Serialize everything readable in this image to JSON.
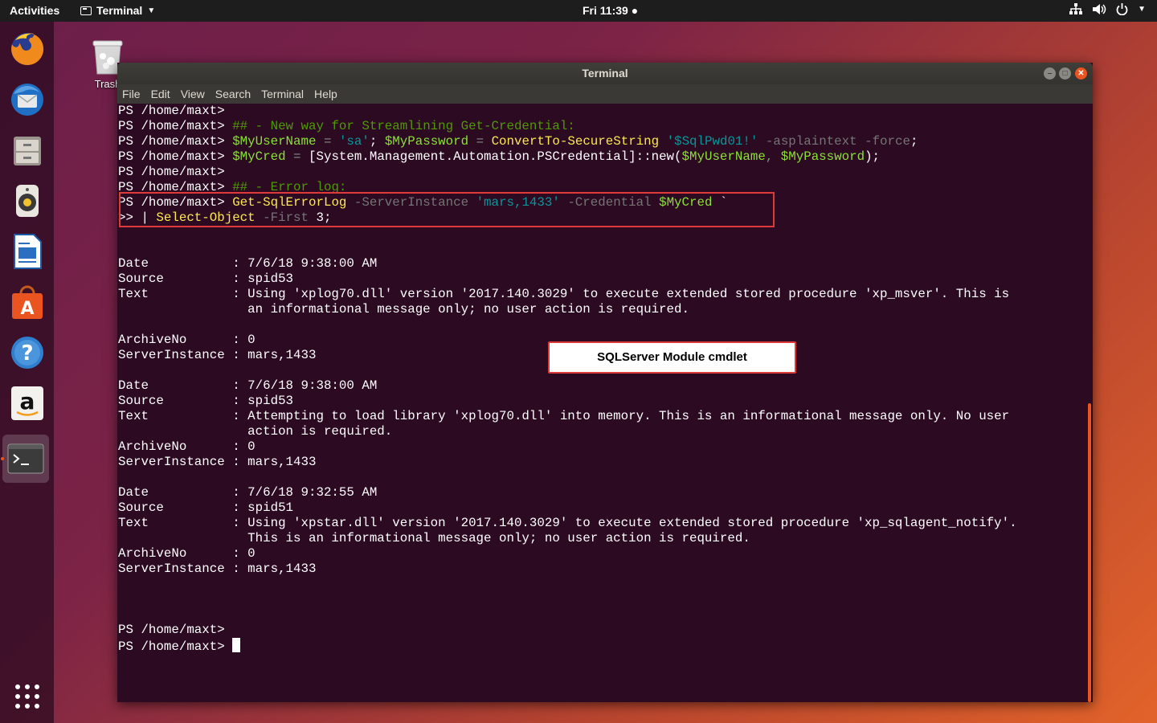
{
  "topbar": {
    "activities": "Activities",
    "app_menu": "Terminal",
    "clock": "Fri 11:39"
  },
  "desktop": {
    "trash_label": "Trash"
  },
  "dock": {
    "items": [
      "firefox-icon",
      "thunderbird-icon",
      "files-icon",
      "rhythmbox-icon",
      "libreoffice-writer-icon",
      "software-center-icon",
      "help-icon",
      "amazon-icon",
      "terminal-icon"
    ],
    "active": "terminal-icon",
    "show_apps": "show-applications-icon"
  },
  "window": {
    "title": "Terminal",
    "menu": [
      "File",
      "Edit",
      "View",
      "Search",
      "Terminal",
      "Help"
    ]
  },
  "terminal": {
    "prompt": "PS /home/maxt>",
    "lines": [
      [
        {
          "t": "PS /home/maxt>",
          "c": ""
        }
      ],
      [
        {
          "t": "PS /home/maxt> ",
          "c": ""
        },
        {
          "t": "## - New way for Streamlining Get-Credential:",
          "c": "cmt"
        }
      ],
      [
        {
          "t": "PS /home/maxt> ",
          "c": ""
        },
        {
          "t": "$MyUserName",
          "c": "var"
        },
        {
          "t": " = ",
          "c": "op"
        },
        {
          "t": "'sa'",
          "c": "str"
        },
        {
          "t": "; ",
          "c": ""
        },
        {
          "t": "$MyPassword",
          "c": "var"
        },
        {
          "t": " = ",
          "c": "op"
        },
        {
          "t": "ConvertTo-SecureString",
          "c": "cmd"
        },
        {
          "t": " ",
          "c": ""
        },
        {
          "t": "'$SqlPwd01!'",
          "c": "str"
        },
        {
          "t": " -asplaintext -force",
          "c": "par"
        },
        {
          "t": ";",
          "c": ""
        }
      ],
      [
        {
          "t": "PS /home/maxt> ",
          "c": ""
        },
        {
          "t": "$MyCred",
          "c": "var"
        },
        {
          "t": " = ",
          "c": "op"
        },
        {
          "t": "[System.Management.Automation.PSCredential]::new(",
          "c": ""
        },
        {
          "t": "$MyUserName",
          "c": "var"
        },
        {
          "t": ", ",
          "c": "op"
        },
        {
          "t": "$MyPassword",
          "c": "var"
        },
        {
          "t": ");",
          "c": ""
        }
      ],
      [
        {
          "t": "PS /home/maxt>",
          "c": ""
        }
      ],
      [
        {
          "t": "PS /home/maxt> ",
          "c": ""
        },
        {
          "t": "## - Error log:",
          "c": "cmt"
        }
      ],
      [
        {
          "t": "PS /home/maxt> ",
          "c": ""
        },
        {
          "t": "Get-SqlErrorLog",
          "c": "cmd"
        },
        {
          "t": " -ServerInstance ",
          "c": "par"
        },
        {
          "t": "'mars,1433'",
          "c": "str"
        },
        {
          "t": " -Credential ",
          "c": "par"
        },
        {
          "t": "$MyCred",
          "c": "var"
        },
        {
          "t": " `",
          "c": ""
        }
      ],
      [
        {
          "t": ">> | ",
          "c": ""
        },
        {
          "t": "Select-Object",
          "c": "cmd"
        },
        {
          "t": " -First",
          "c": "par"
        },
        {
          "t": " 3;",
          "c": ""
        }
      ],
      [
        {
          "t": "",
          "c": ""
        }
      ],
      [
        {
          "t": "",
          "c": ""
        }
      ],
      [
        {
          "t": "Date           : 7/6/18 9:38:00 AM",
          "c": ""
        }
      ],
      [
        {
          "t": "Source         : spid53",
          "c": ""
        }
      ],
      [
        {
          "t": "Text           : Using 'xplog70.dll' version '2017.140.3029' to execute extended stored procedure 'xp_msver'. This is",
          "c": ""
        }
      ],
      [
        {
          "t": "                 an informational message only; no user action is required.",
          "c": ""
        }
      ],
      [
        {
          "t": "",
          "c": ""
        }
      ],
      [
        {
          "t": "ArchiveNo      : 0",
          "c": ""
        }
      ],
      [
        {
          "t": "ServerInstance : mars,1433",
          "c": ""
        }
      ],
      [
        {
          "t": "",
          "c": ""
        }
      ],
      [
        {
          "t": "Date           : 7/6/18 9:38:00 AM",
          "c": ""
        }
      ],
      [
        {
          "t": "Source         : spid53",
          "c": ""
        }
      ],
      [
        {
          "t": "Text           : Attempting to load library 'xplog70.dll' into memory. This is an informational message only. No user",
          "c": ""
        }
      ],
      [
        {
          "t": "                 action is required.",
          "c": ""
        }
      ],
      [
        {
          "t": "ArchiveNo      : 0",
          "c": ""
        }
      ],
      [
        {
          "t": "ServerInstance : mars,1433",
          "c": ""
        }
      ],
      [
        {
          "t": "",
          "c": ""
        }
      ],
      [
        {
          "t": "Date           : 7/6/18 9:32:55 AM",
          "c": ""
        }
      ],
      [
        {
          "t": "Source         : spid51",
          "c": ""
        }
      ],
      [
        {
          "t": "Text           : Using 'xpstar.dll' version '2017.140.3029' to execute extended stored procedure 'xp_sqlagent_notify'.",
          "c": ""
        }
      ],
      [
        {
          "t": "                 This is an informational message only; no user action is required.",
          "c": ""
        }
      ],
      [
        {
          "t": "ArchiveNo      : 0",
          "c": ""
        }
      ],
      [
        {
          "t": "ServerInstance : mars,1433",
          "c": ""
        }
      ],
      [
        {
          "t": "",
          "c": ""
        }
      ],
      [
        {
          "t": "",
          "c": ""
        }
      ],
      [
        {
          "t": "",
          "c": ""
        }
      ],
      [
        {
          "t": "PS /home/maxt>",
          "c": ""
        }
      ],
      [
        {
          "t": "PS /home/maxt> ",
          "c": ""
        },
        {
          "t": "",
          "c": "cursor"
        }
      ]
    ]
  },
  "annotation": {
    "callout": "SQLServer Module cmdlet"
  },
  "colors": {
    "accent": "#e95420",
    "terminal_bg": "#2c0a22",
    "highlight_border": "#e0393a"
  }
}
